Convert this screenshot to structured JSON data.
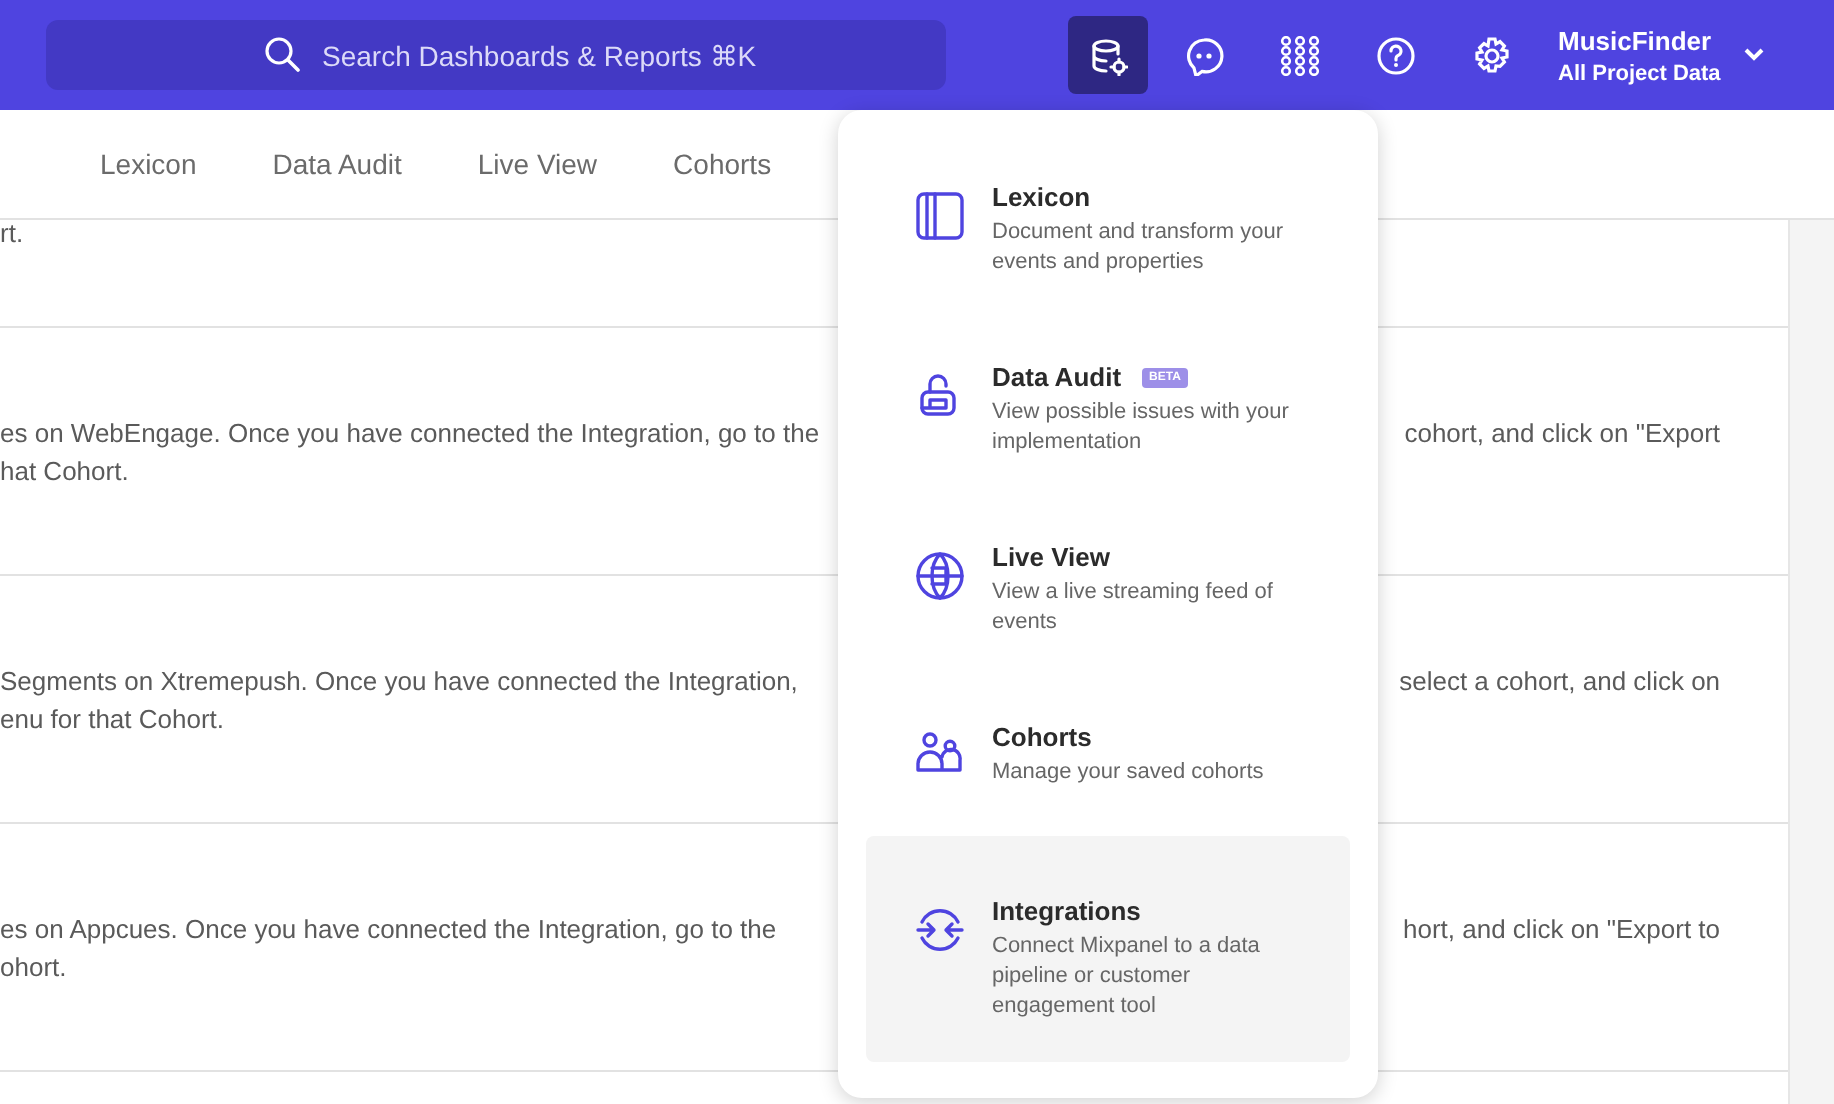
{
  "header": {
    "search": {
      "placeholder": "Search Dashboards & Reports ⌘K"
    },
    "icon_buttons": [
      {
        "kind": "database",
        "selected": true
      },
      {
        "kind": "chat",
        "selected": false
      },
      {
        "kind": "apps",
        "selected": false
      },
      {
        "kind": "help",
        "selected": false
      },
      {
        "kind": "settings",
        "selected": false
      }
    ],
    "project": {
      "name": "MusicFinder",
      "scope": "All Project Data"
    }
  },
  "tabs": [
    {
      "label": "Lexicon",
      "selected": false
    },
    {
      "label": "Data Audit",
      "selected": false
    },
    {
      "label": "Live View",
      "selected": false
    },
    {
      "label": "Cohorts",
      "selected": false
    }
  ],
  "rows": [
    {
      "lines": [
        {
          "left": "rt."
        }
      ]
    },
    {
      "lines": [
        {
          "left": "es on WebEngage. Once you have connected the Integration, go to the",
          "right": "cohort, and click on \"Export"
        },
        {
          "left": "hat Cohort."
        }
      ]
    },
    {
      "lines": [
        {
          "left": "Segments on Xtremepush. Once you have connected the Integration,",
          "right": "select a cohort, and click on"
        },
        {
          "left": "enu for that Cohort."
        }
      ]
    },
    {
      "lines": [
        {
          "left": "es on Appcues. Once you have connected the Integration, go to the",
          "right": "hort, and click on \"Export to"
        },
        {
          "left": "ohort."
        }
      ]
    },
    {
      "lines": []
    }
  ],
  "menu": {
    "items": [
      {
        "kind": "lexicon",
        "title": "Lexicon",
        "description": "Document and transform your events and properties",
        "selected": false
      },
      {
        "kind": "audit",
        "title": "Data Audit",
        "badge": "BETA",
        "description": "View possible issues with your implementation",
        "selected": false
      },
      {
        "kind": "live",
        "title": "Live View",
        "description": "View a live streaming feed of events",
        "selected": false
      },
      {
        "kind": "cohorts",
        "title": "Cohorts",
        "description": "Manage your saved cohorts",
        "selected": false
      },
      {
        "kind": "integrations",
        "title": "Integrations",
        "description": "Connect Mixpanel to a data pipeline or customer engagement tool",
        "selected": true
      }
    ]
  }
}
